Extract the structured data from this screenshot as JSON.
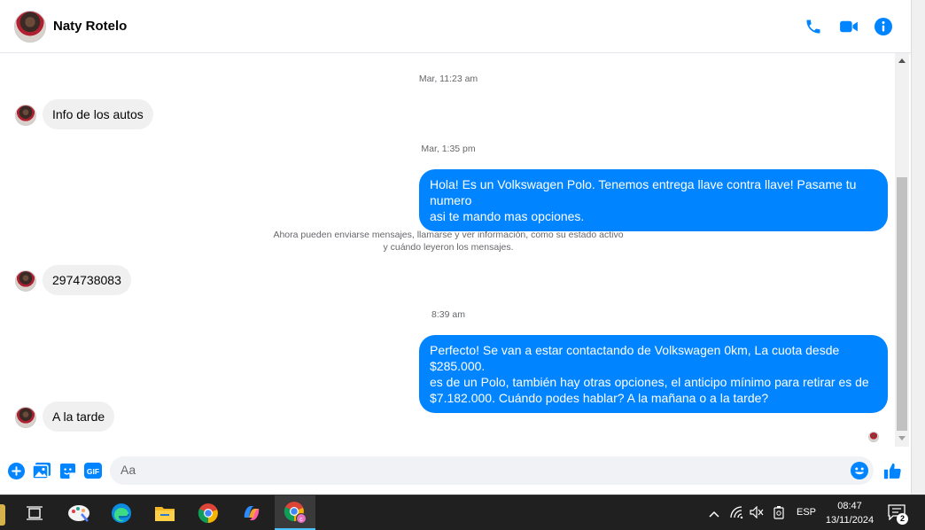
{
  "header": {
    "contact_name": "Naty Rotelo",
    "icons": [
      "phone-icon",
      "video-camera-icon",
      "info-icon"
    ],
    "accent_color": "#0084ff"
  },
  "messages": {
    "timestamps": [
      "Mar, 11:23 am",
      "Mar, 1:35 pm",
      "8:39 am"
    ],
    "incoming": [
      {
        "text": "Info de los autos"
      },
      {
        "text": "2974738083"
      },
      {
        "text": "A la tarde"
      }
    ],
    "outgoing": [
      {
        "lines": [
          "Hola! Es un Volkswagen Polo. Tenemos entrega llave contra llave! Pasame tu numero",
          "asi te mando mas opciones."
        ]
      },
      {
        "lines": [
          "Perfecto!  Se van a estar contactando de Volkswagen 0km, La cuota desde $285.000.",
          "es de un Polo, también hay otras opciones, el anticipo mínimo para retirar es de",
          "$7.182.000. Cuándo podes hablar? A la mañana o a la tarde?"
        ]
      }
    ],
    "system_message": {
      "lines": [
        "Ahora pueden enviarse mensajes, llamarse y ver información, como su estado activo",
        "y cuándo leyeron los mensajes."
      ]
    }
  },
  "composer": {
    "placeholder": "Aa",
    "icons": [
      "plus-icon",
      "image-icon",
      "sticker-icon",
      "gif-icon",
      "emoji-icon",
      "thumbs-up-icon"
    ],
    "gif_label": "GIF"
  },
  "taskbar": {
    "apps": [
      "task-view-icon",
      "paint-icon",
      "edge-icon",
      "file-explorer-icon",
      "chrome-icon",
      "copilot-icon",
      "chrome-profile-icon"
    ],
    "language": "ESP",
    "time": "08:47",
    "date": "13/11/2024",
    "notification_count": "2"
  }
}
